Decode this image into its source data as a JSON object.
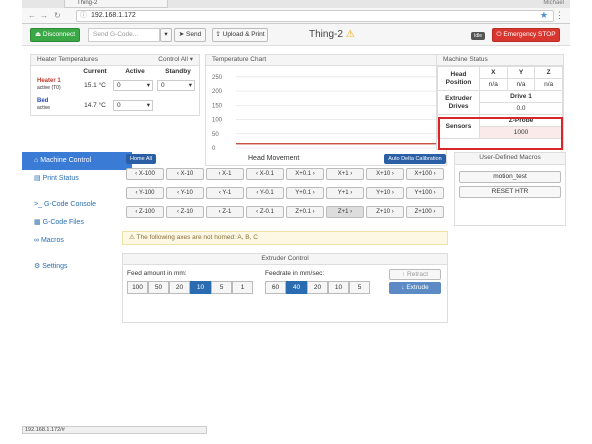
{
  "browser": {
    "tab_title": "Thing-2",
    "user_name": "Michael",
    "url": "192.168.1.172",
    "status_url": "192.168.1.172/#"
  },
  "toolbar": {
    "disconnect": "Disconnect",
    "gcode_placeholder": "Send G-Code...",
    "send": "Send",
    "upload_print": "Upload & Print",
    "title": "Thing-2",
    "status_badge": "Idle",
    "emergency_stop": "Emergency STOP"
  },
  "heater_panel": {
    "title": "Heater Temperatures",
    "control_all": "Control All",
    "headers": [
      "",
      "Current",
      "Active",
      "Standby"
    ],
    "rows": [
      {
        "name": "Heater 1",
        "state": "active (T0)",
        "current": "15.1 °C",
        "active": "0",
        "standby": "0"
      },
      {
        "name": "Bed",
        "state": "active",
        "current": "14.7 °C",
        "active": "0",
        "standby": ""
      }
    ]
  },
  "temp_chart": {
    "title": "Temperature Chart"
  },
  "chart_data": {
    "type": "line",
    "title": "Temperature Chart",
    "yticks": [
      0,
      50,
      100,
      150,
      200,
      250
    ],
    "ylim": [
      0,
      260
    ],
    "series": [
      {
        "color": "#c0392b",
        "values": [
          15,
          15,
          15,
          15,
          15
        ]
      }
    ]
  },
  "machine_status": {
    "title": "Machine Status",
    "axes": [
      "X",
      "Y",
      "Z"
    ],
    "head_position_label": "Head Position",
    "head_position": [
      "n/a",
      "n/a",
      "n/a"
    ],
    "extruder_label": "Extruder Drives",
    "drive_label": "Drive 1",
    "drive_value": "0.0",
    "sensors_label": "Sensors",
    "zprobe_label": "Z-Probe",
    "zprobe_value": "1000"
  },
  "sidebar": {
    "items": [
      {
        "label": "Machine Control",
        "icon": "home-icon"
      },
      {
        "label": "Print Status",
        "icon": "print-icon"
      },
      {
        "label": "G-Code Console",
        "icon": "console-icon"
      },
      {
        "label": "G-Code Files",
        "icon": "files-icon"
      },
      {
        "label": "Macros",
        "icon": "macros-icon"
      },
      {
        "label": "Settings",
        "icon": "gear-icon"
      }
    ]
  },
  "head_movement": {
    "home_all": "Home All",
    "title": "Head Movement",
    "auto_delta": "Auto Delta Calibration",
    "rows": [
      [
        "X-100",
        "X-10",
        "X-1",
        "X-0.1",
        "X+0.1",
        "X+1",
        "X+10",
        "X+100"
      ],
      [
        "Y-100",
        "Y-10",
        "Y-1",
        "Y-0.1",
        "Y+0.1",
        "Y+1",
        "Y+10",
        "Y+100"
      ],
      [
        "Z-100",
        "Z-10",
        "Z-1",
        "Z-0.1",
        "Z+0.1",
        "Z+1",
        "Z+10",
        "Z+100"
      ]
    ],
    "warning": "The following axes are not homed: A, B, C"
  },
  "macros": {
    "title": "User-Defined Macros",
    "items": [
      "motion_test",
      "RESET HTR"
    ]
  },
  "extruder": {
    "title": "Extruder Control",
    "feed_label": "Feed amount in mm:",
    "feed_values": [
      "100",
      "50",
      "20",
      "10",
      "5",
      "1"
    ],
    "feed_selected": "10",
    "rate_label": "Feedrate in mm/sec:",
    "rate_values": [
      "60",
      "40",
      "20",
      "10",
      "5"
    ],
    "rate_selected": "40",
    "retract": "Retract",
    "extrude": "Extrude"
  }
}
